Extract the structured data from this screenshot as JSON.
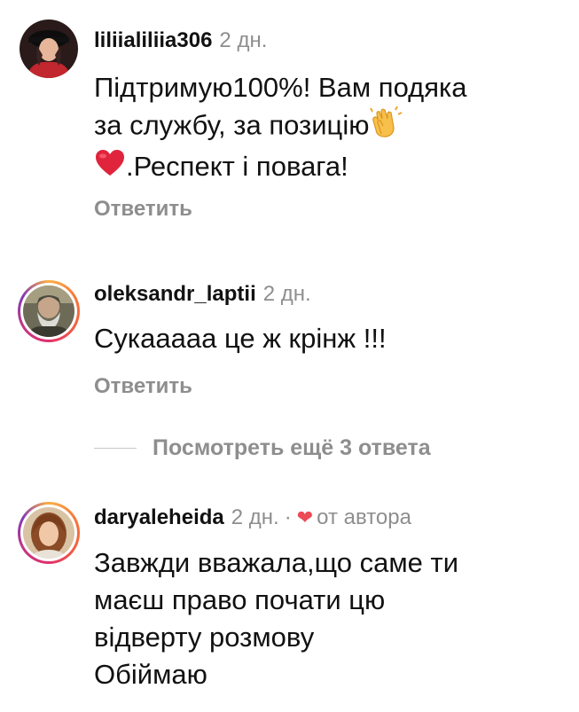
{
  "comments": [
    {
      "username": "liliialiliia306",
      "time": "2 дн.",
      "text_line1": "Підтримую100%! Вам подяка",
      "text_line2": "за службу, за позицію",
      "text_line3": ".Респект і повага!",
      "reply_label": "Ответить",
      "icons": [
        "clapping-hands-emoji",
        "red-heart-emoji"
      ]
    },
    {
      "username": "oleksandr_laptii",
      "time": "2 дн.",
      "text_line1": "Сукааааа це ж крінж !!!",
      "reply_label": "Ответить"
    },
    {
      "username": "daryaleheida",
      "time": "2 дн.",
      "separator": "·",
      "author_label": "от автора",
      "text_line1": "Завжди вважала,що саме ти",
      "text_line2": "маєш право почати цю",
      "text_line3": "відверту розмову",
      "text_line4": "Обіймаю",
      "icons": [
        "liked-by-author-heart-icon"
      ]
    }
  ],
  "view_more_replies": "Посмотреть ещё 3 ответа",
  "colors": {
    "text": "#111111",
    "secondary": "#8e8e8e",
    "heart": "#ed4956",
    "divider": "#c7c7c7"
  }
}
